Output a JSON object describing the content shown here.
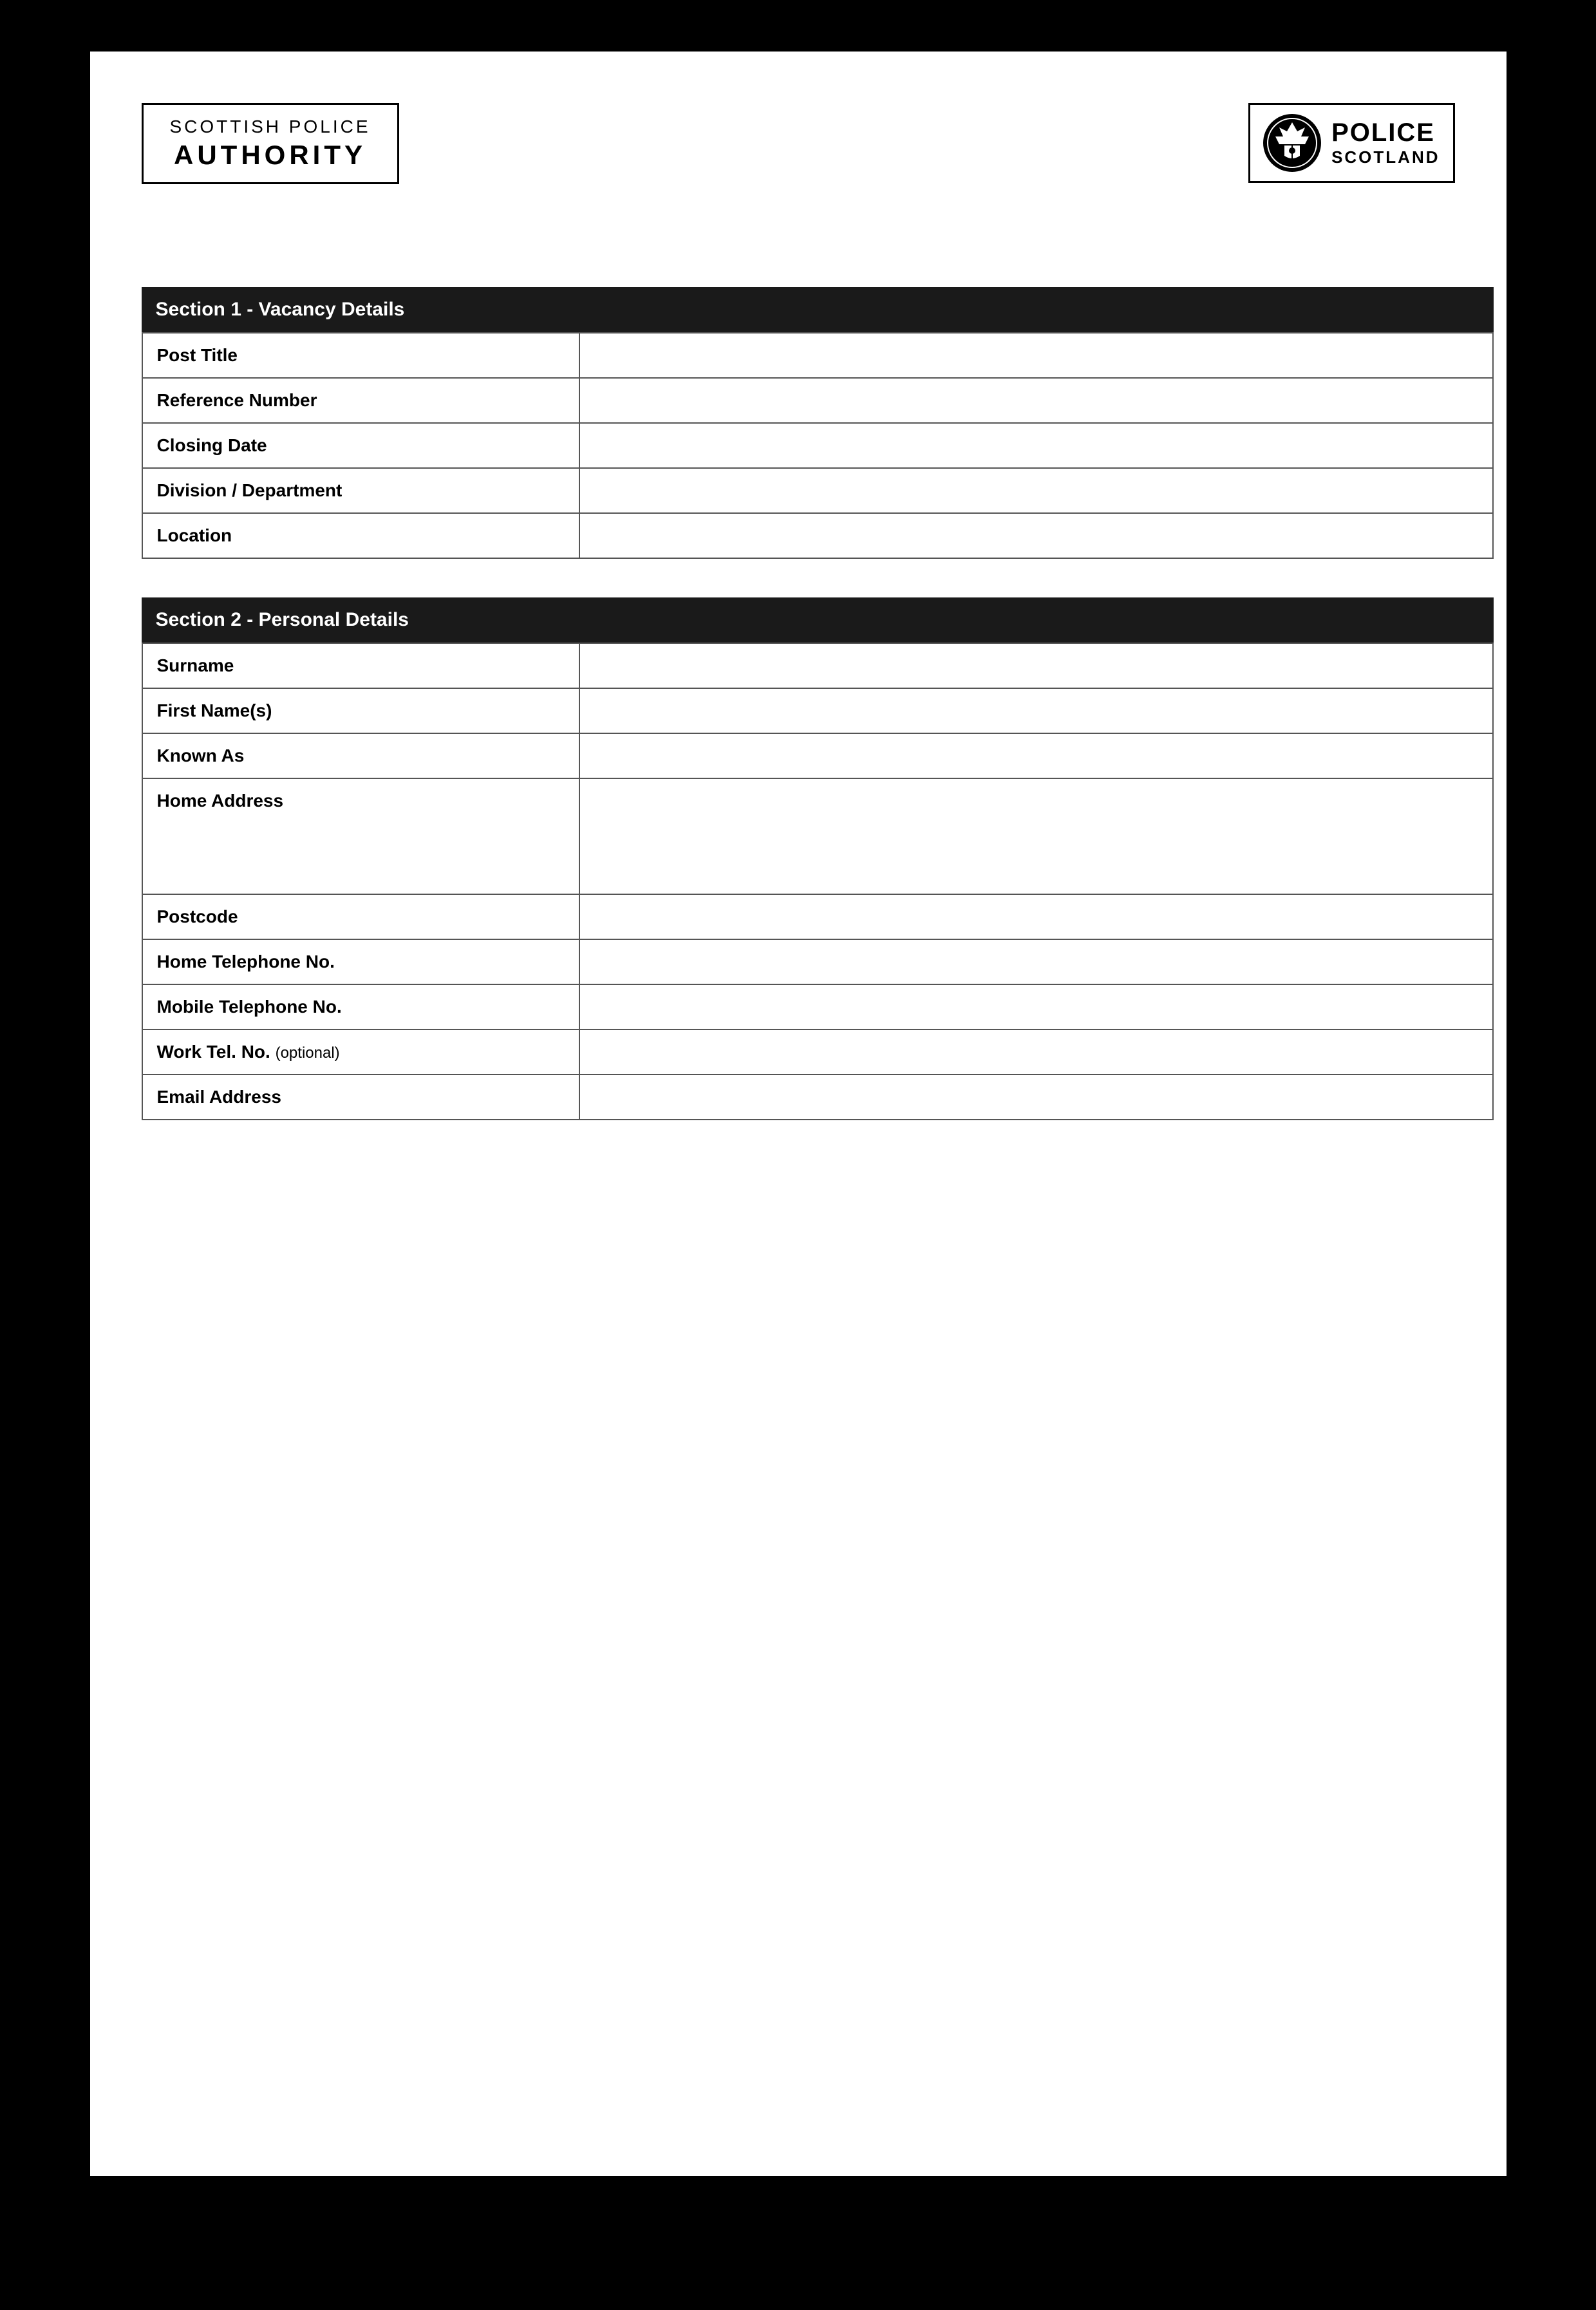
{
  "header": {
    "spa_logo": {
      "line1": "SCOTTISH POLICE",
      "line2": "AUTHORITY"
    },
    "police_logo": {
      "badge_icon": "🏵",
      "line1": "POLICE",
      "line2": "SCOTLAND"
    }
  },
  "section1": {
    "title": "Section 1 - Vacancy Details",
    "fields": [
      {
        "label": "Post Title",
        "id": "post-title",
        "tall": false
      },
      {
        "label": "Reference Number",
        "id": "reference-number",
        "tall": false
      },
      {
        "label": "Closing Date",
        "id": "closing-date",
        "tall": false
      },
      {
        "label": "Division / Department",
        "id": "division-department",
        "tall": false
      },
      {
        "label": "Location",
        "id": "location",
        "tall": false
      }
    ]
  },
  "section2": {
    "title": "Section 2 - Personal Details",
    "fields": [
      {
        "label": "Surname",
        "id": "surname",
        "tall": false,
        "optional": false
      },
      {
        "label": "First Name(s)",
        "id": "first-names",
        "tall": false,
        "optional": false
      },
      {
        "label": "Known As",
        "id": "known-as",
        "tall": false,
        "optional": false
      },
      {
        "label": "Home Address",
        "id": "home-address",
        "tall": true,
        "optional": false
      },
      {
        "label": "Postcode",
        "id": "postcode",
        "tall": false,
        "optional": false
      },
      {
        "label": "Home Telephone No.",
        "id": "home-telephone",
        "tall": false,
        "optional": false
      },
      {
        "label": "Mobile Telephone No.",
        "id": "mobile-telephone",
        "tall": false,
        "optional": false
      },
      {
        "label": "Work Tel. No.",
        "id": "work-telephone",
        "tall": false,
        "optional": true,
        "optional_text": "(optional)"
      },
      {
        "label": "Email Address",
        "id": "email-address",
        "tall": false,
        "optional": false
      }
    ]
  }
}
